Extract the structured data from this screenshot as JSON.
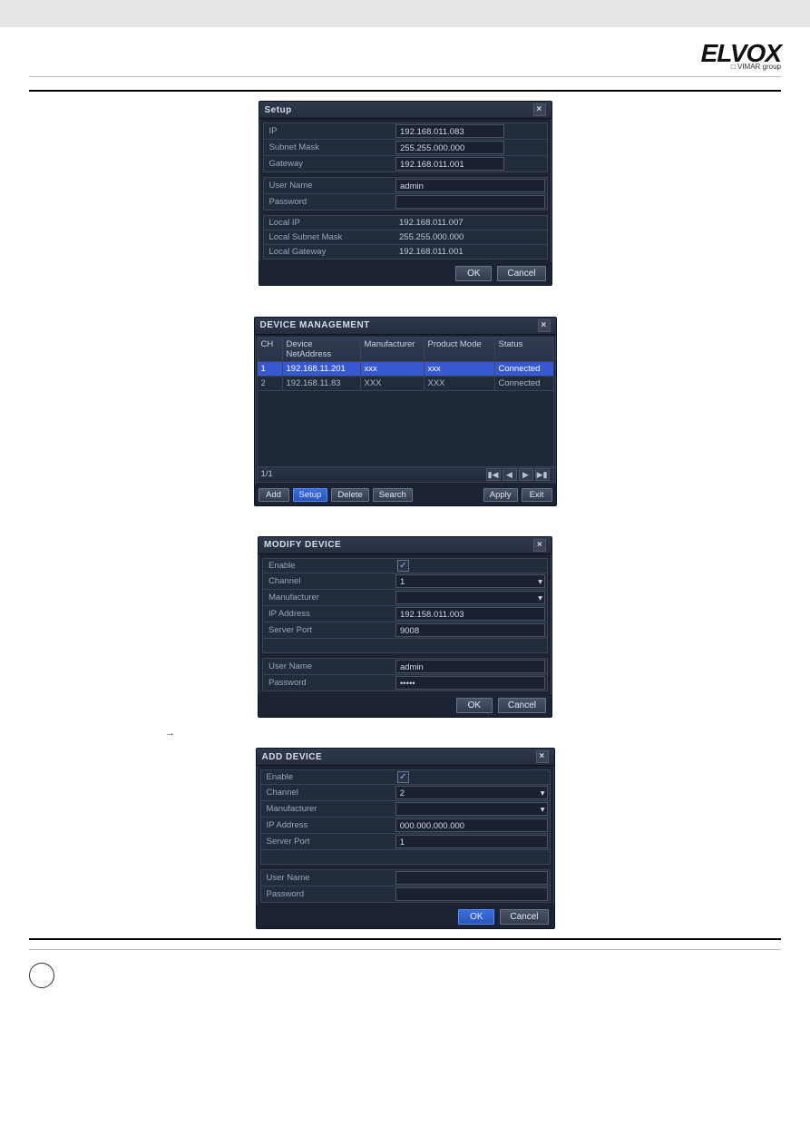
{
  "header": {
    "logo": "ELVOX",
    "logo_sub": "□ VIMAR group"
  },
  "text_above_setup": "",
  "setup": {
    "title": "Setup",
    "rows": {
      "ip_label": "IP",
      "ip_value": "192.168.011.083",
      "subnet_label": "Subnet Mask",
      "subnet_value": "255.255.000.000",
      "gateway_label": "Gateway",
      "gateway_value": "192.168.011.001",
      "user_label": "User Name",
      "user_value": "admin",
      "pass_label": "Password",
      "pass_value": "",
      "localip_label": "Local IP",
      "localip_value": "192.168.011.007",
      "localsubnet_label": "Local Subnet Mask",
      "localsubnet_value": "255.255.000.000",
      "localgw_label": "Local Gateway",
      "localgw_value": "192.168.011.001"
    },
    "ok": "OK",
    "cancel": "Cancel"
  },
  "dm": {
    "title": "DEVICE MANAGEMENT",
    "head": {
      "ch": "CH",
      "ip": "Device NetAddress",
      "mf": "Manufacturer",
      "pm": "Product Mode",
      "st": "Status"
    },
    "rows": [
      {
        "ch": "1",
        "ip": "192.168.11.201",
        "mf": "xxx",
        "pm": "xxx",
        "st": "Connected"
      },
      {
        "ch": "2",
        "ip": "192.168.11.83",
        "mf": "XXX",
        "pm": "XXX",
        "st": "Connected"
      }
    ],
    "pager": "1/1",
    "buttons": {
      "add": "Add",
      "setup": "Setup",
      "delete": "Delete",
      "search": "Search",
      "apply": "Apply",
      "exit": "Exit"
    }
  },
  "modify": {
    "title": "MODIFY DEVICE",
    "rows": {
      "enable_label": "Enable",
      "enable_value": "✓",
      "channel_label": "Channel",
      "channel_value": "1",
      "mf_label": "Manufacturer",
      "mf_value": "",
      "ip_label": "IP Address",
      "ip_value": "192.158.011.003",
      "port_label": "Server Port",
      "port_value": "9008",
      "user_label": "User Name",
      "user_value": "admin",
      "pass_label": "Password",
      "pass_value": "•••••"
    },
    "ok": "OK",
    "cancel": "Cancel"
  },
  "add": {
    "title": "ADD DEVICE",
    "rows": {
      "enable_label": "Enable",
      "enable_value": "✓",
      "channel_label": "Channel",
      "channel_value": "2",
      "mf_label": "Manufacturer",
      "mf_value": "",
      "ip_label": "IP Address",
      "ip_value": "000.000.000.000",
      "port_label": "Server Port",
      "port_value": "1",
      "user_label": "User Name",
      "user_value": "",
      "pass_label": "Password",
      "pass_value": ""
    },
    "ok": "OK",
    "cancel": "Cancel"
  },
  "arrow_line_prefix": "→",
  "page_number": ""
}
